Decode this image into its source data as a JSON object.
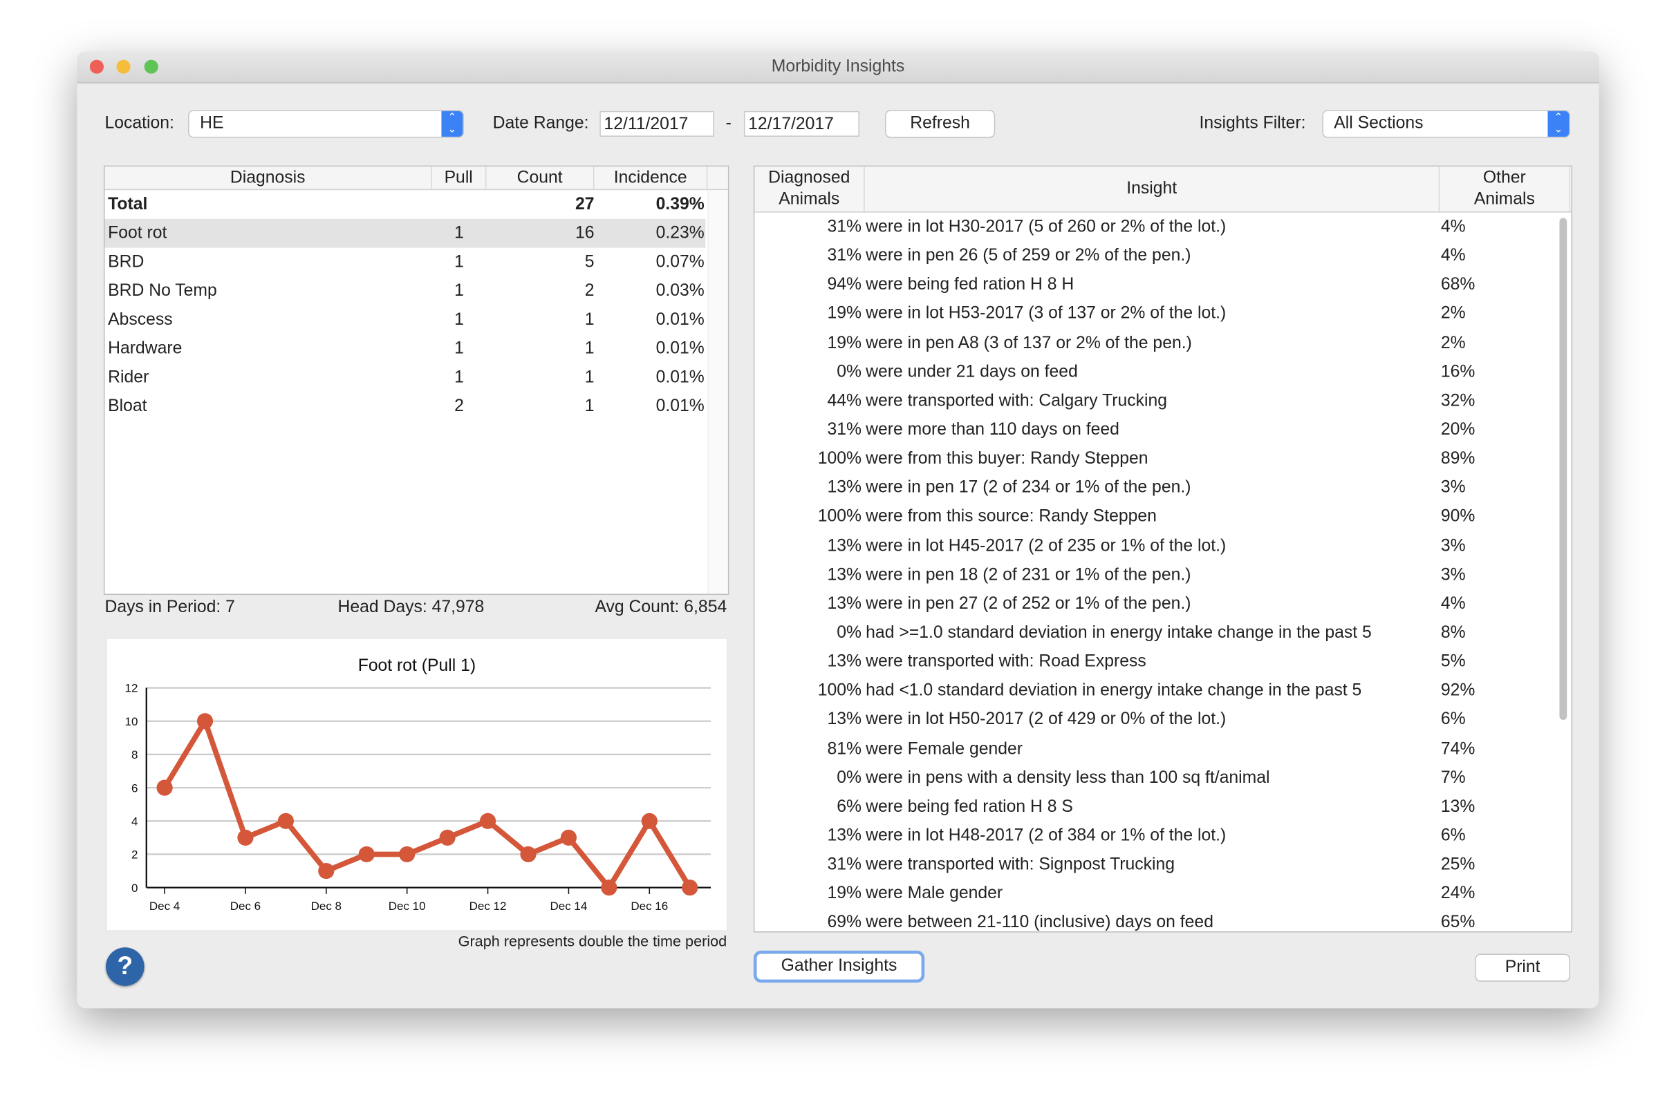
{
  "window": {
    "title": "Morbidity Insights"
  },
  "toolbar": {
    "location_label": "Location:",
    "location_value": "HE",
    "date_range_label": "Date Range:",
    "date_start": "12/11/2017",
    "date_sep": "-",
    "date_end": "12/17/2017",
    "refresh_label": "Refresh",
    "filter_label": "Insights Filter:",
    "filter_value": "All Sections"
  },
  "diagnosis_table": {
    "headers": [
      "Diagnosis",
      "Pull",
      "Count",
      "Incidence"
    ],
    "total": {
      "name": "Total",
      "count": "27",
      "incidence": "0.39%"
    },
    "rows": [
      {
        "name": "Foot rot",
        "pull": "1",
        "count": "16",
        "incidence": "0.23%"
      },
      {
        "name": "BRD",
        "pull": "1",
        "count": "5",
        "incidence": "0.07%"
      },
      {
        "name": "BRD No Temp",
        "pull": "1",
        "count": "2",
        "incidence": "0.03%"
      },
      {
        "name": "Abscess",
        "pull": "1",
        "count": "1",
        "incidence": "0.01%"
      },
      {
        "name": "Hardware",
        "pull": "1",
        "count": "1",
        "incidence": "0.01%"
      },
      {
        "name": "Rider",
        "pull": "1",
        "count": "1",
        "incidence": "0.01%"
      },
      {
        "name": "Bloat",
        "pull": "2",
        "count": "1",
        "incidence": "0.01%"
      }
    ],
    "selected_row": 0
  },
  "summary": {
    "days": "Days in Period: 7",
    "head_days": "Head Days: 47,978",
    "avg_count": "Avg Count: 6,854"
  },
  "chart_note": "Graph represents double the time period",
  "chart_data": {
    "type": "line",
    "title": "Foot rot (Pull 1)",
    "x": [
      "Dec 4",
      "Dec 5",
      "Dec 6",
      "Dec 7",
      "Dec 8",
      "Dec 9",
      "Dec 10",
      "Dec 11",
      "Dec 12",
      "Dec 13",
      "Dec 14",
      "Dec 15",
      "Dec 16",
      "Dec 17"
    ],
    "values": [
      6,
      10,
      3,
      4,
      1,
      2,
      2,
      3,
      4,
      2,
      3,
      0,
      4,
      0
    ],
    "xticks": [
      "Dec 4",
      "Dec 6",
      "Dec 8",
      "Dec 10",
      "Dec 12",
      "Dec 14",
      "Dec 16"
    ],
    "yticks": [
      "0",
      "2",
      "4",
      "6",
      "8",
      "10",
      "12"
    ],
    "ylim": [
      0,
      12
    ],
    "grid": true,
    "color": "#d4573a"
  },
  "insights_table": {
    "headers": {
      "diagnosed": "Diagnosed Animals",
      "insight": "Insight",
      "other": "Other Animals"
    },
    "rows": [
      {
        "pct": "31%",
        "text": "were in lot H30-2017 (5 of 260 or 2% of the lot.)",
        "other": "4%"
      },
      {
        "pct": "31%",
        "text": "were in pen 26 (5 of 259 or 2% of the pen.)",
        "other": "4%"
      },
      {
        "pct": "94%",
        "text": "were being fed ration H 8 H",
        "other": "68%"
      },
      {
        "pct": "19%",
        "text": "were in lot H53-2017 (3 of 137 or 2% of the lot.)",
        "other": "2%"
      },
      {
        "pct": "19%",
        "text": "were in pen A8 (3 of 137 or 2% of the pen.)",
        "other": "2%"
      },
      {
        "pct": "0%",
        "text": "were under 21 days on feed",
        "other": "16%"
      },
      {
        "pct": "44%",
        "text": "were transported with: Calgary Trucking",
        "other": "32%"
      },
      {
        "pct": "31%",
        "text": "were more than 110 days on feed",
        "other": "20%"
      },
      {
        "pct": "100%",
        "text": "were from this buyer: Randy Steppen",
        "other": "89%"
      },
      {
        "pct": "13%",
        "text": "were in pen 17 (2 of 234 or 1% of the pen.)",
        "other": "3%"
      },
      {
        "pct": "100%",
        "text": "were from this source: Randy Steppen",
        "other": "90%"
      },
      {
        "pct": "13%",
        "text": "were in lot H45-2017 (2 of 235 or 1% of the lot.)",
        "other": "3%"
      },
      {
        "pct": "13%",
        "text": "were in pen 18 (2 of 231 or 1% of the pen.)",
        "other": "3%"
      },
      {
        "pct": "13%",
        "text": "were in pen 27 (2 of 252 or 1% of the pen.)",
        "other": "4%"
      },
      {
        "pct": "0%",
        "text": "had >=1.0 standard deviation in energy intake change in the past 5",
        "other": "8%"
      },
      {
        "pct": "13%",
        "text": "were transported with: Road Express",
        "other": "5%"
      },
      {
        "pct": "100%",
        "text": "had <1.0 standard deviation in energy intake change in the past 5",
        "other": "92%"
      },
      {
        "pct": "13%",
        "text": "were in lot H50-2017 (2 of 429 or 0% of the lot.)",
        "other": "6%"
      },
      {
        "pct": "81%",
        "text": "were Female gender",
        "other": "74%"
      },
      {
        "pct": "0%",
        "text": "were in pens with a density less than 100 sq ft/animal",
        "other": "7%"
      },
      {
        "pct": "6%",
        "text": "were being fed ration H 8 S",
        "other": "13%"
      },
      {
        "pct": "13%",
        "text": "were in lot H48-2017 (2 of 384 or 1% of the lot.)",
        "other": "6%"
      },
      {
        "pct": "31%",
        "text": "were transported with: Signpost Trucking",
        "other": "25%"
      },
      {
        "pct": "19%",
        "text": "were Male gender",
        "other": "24%"
      },
      {
        "pct": "69%",
        "text": "were between 21-110 (inclusive) days on feed",
        "other": "65%"
      }
    ]
  },
  "buttons": {
    "gather": "Gather Insights",
    "print": "Print",
    "help": "?"
  }
}
